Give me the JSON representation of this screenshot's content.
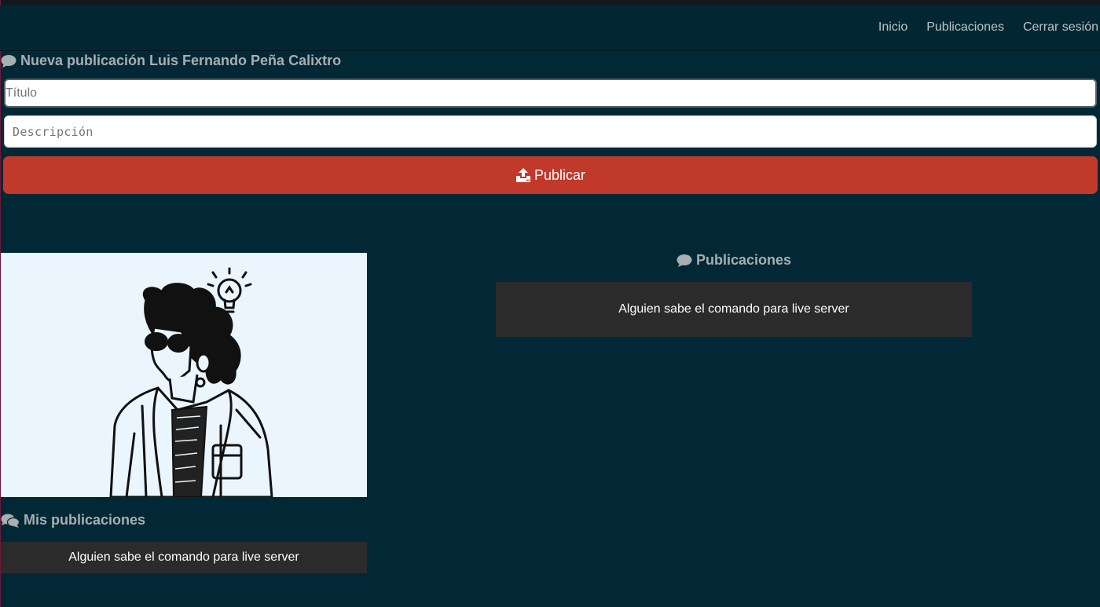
{
  "nav": {
    "links": [
      "Inicio",
      "Publicaciones",
      "Cerrar sesión"
    ]
  },
  "new_post": {
    "heading": "Nueva publicación Luis Fernando Peña Calixtro",
    "title_placeholder": "Título",
    "description_placeholder": "Descripción",
    "submit_label": "Publicar"
  },
  "my_posts": {
    "heading": "Mis publicaciones",
    "items": [
      "Alguien sabe el comando para live server"
    ]
  },
  "feed": {
    "heading": "Publicaciones",
    "items": [
      "Alguien sabe el comando para live server"
    ]
  },
  "icons": {
    "new_post": "comment-icon",
    "submit": "upload-icon",
    "my_posts": "comments-icon",
    "feed": "comment-icon"
  },
  "colors": {
    "background": "#022836",
    "button": "#c0392b",
    "card": "#2b2b2b",
    "heading": "#a8aeb1"
  }
}
